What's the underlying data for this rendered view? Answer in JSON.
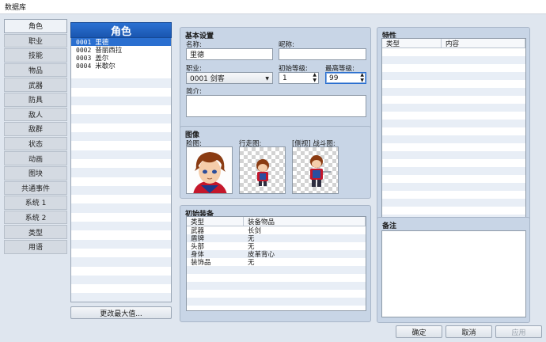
{
  "window": {
    "title": "数据库"
  },
  "tabs": [
    {
      "label": "角色",
      "active": true
    },
    {
      "label": "职业"
    },
    {
      "label": "技能"
    },
    {
      "label": "物品"
    },
    {
      "label": "武器"
    },
    {
      "label": "防具"
    },
    {
      "label": "敌人"
    },
    {
      "label": "敌群"
    },
    {
      "label": "状态"
    },
    {
      "label": "动画"
    },
    {
      "label": "图块"
    },
    {
      "label": "共通事件"
    },
    {
      "label": "系统 1"
    },
    {
      "label": "系统 2"
    },
    {
      "label": "类型"
    },
    {
      "label": "用语"
    }
  ],
  "actor_list": {
    "header": "角色",
    "items": [
      {
        "num": "0001",
        "name": "里德",
        "selected": true
      },
      {
        "num": "0002",
        "name": "普丽西拉"
      },
      {
        "num": "0003",
        "name": "盖尔"
      },
      {
        "num": "0004",
        "name": "米歇尔"
      }
    ],
    "change_max_label": "更改最大值..."
  },
  "basic": {
    "title": "基本设置",
    "name_label": "名称:",
    "name_value": "里德",
    "nickname_label": "昵称:",
    "nickname_value": "",
    "class_label": "职业:",
    "class_value": "0001 剑客",
    "initial_level_label": "初始等级:",
    "initial_level_value": "1",
    "max_level_label": "最高等级:",
    "max_level_value": "99",
    "profile_label": "简介:",
    "profile_value": ""
  },
  "images": {
    "title": "图像",
    "face_label": "脸图:",
    "character_label": "行走图:",
    "battler_label": "[侧视] 战斗图:"
  },
  "equipment": {
    "title": "初始装备",
    "col_type": "类型",
    "col_item": "装备物品",
    "rows": [
      {
        "type": "武器",
        "item": "长剑"
      },
      {
        "type": "盾牌",
        "item": "无"
      },
      {
        "type": "头部",
        "item": "无"
      },
      {
        "type": "身体",
        "item": "皮革背心"
      },
      {
        "type": "装饰品",
        "item": "无"
      }
    ]
  },
  "traits": {
    "title": "特性",
    "col_type": "类型",
    "col_content": "内容"
  },
  "note": {
    "title": "备注",
    "value": ""
  },
  "footer": {
    "ok": "确定",
    "cancel": "取消",
    "apply": "应用"
  },
  "colors": {
    "selection": "#2a6fd0",
    "panel": "#c8d5e6",
    "header": "#1a56b0"
  }
}
